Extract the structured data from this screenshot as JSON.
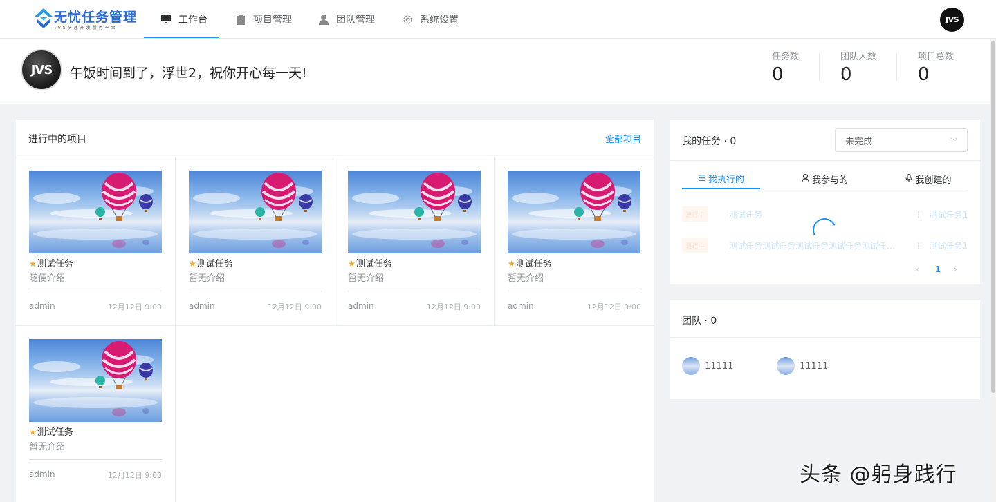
{
  "logo": {
    "title": "无忧任务管理",
    "subtitle": "JVS快速开发服务平台"
  },
  "nav": {
    "tabs": [
      {
        "label": "工作台",
        "icon": "monitor-icon"
      },
      {
        "label": "项目管理",
        "icon": "clipboard-icon"
      },
      {
        "label": "团队管理",
        "icon": "user-icon"
      },
      {
        "label": "系统设置",
        "icon": "gear-icon"
      }
    ],
    "active": "工作台",
    "avatar_text": "JVS"
  },
  "greeting": {
    "avatar_text": "JVS",
    "message": "午饭时间到了，浮世2，祝你开心每一天!",
    "stats": [
      {
        "label": "任务数",
        "value": "0"
      },
      {
        "label": "团队人数",
        "value": "0"
      },
      {
        "label": "项目总数",
        "value": "0"
      }
    ]
  },
  "projects_panel": {
    "title": "进行中的项目",
    "link": "全部项目",
    "cards": [
      {
        "name": "测试任务",
        "desc": "随便介绍",
        "owner": "admin",
        "date": "12月12日 9:00"
      },
      {
        "name": "测试任务",
        "desc": "暂无介绍",
        "owner": "admin",
        "date": "12月12日 9:00"
      },
      {
        "name": "测试任务",
        "desc": "暂无介绍",
        "owner": "admin",
        "date": "12月12日 9:00"
      },
      {
        "name": "测试任务",
        "desc": "暂无介绍",
        "owner": "admin",
        "date": "12月12日 9:00"
      },
      {
        "name": "测试任务",
        "desc": "暂无介绍",
        "owner": "admin",
        "date": "12月12日 9:00"
      }
    ]
  },
  "tasks_panel": {
    "title": "我的任务 · 0",
    "filter": "未完成",
    "tabs": [
      {
        "label": "我执行的",
        "icon": "list-icon"
      },
      {
        "label": "我参与的",
        "icon": "user-icon"
      },
      {
        "label": "我创建的",
        "icon": "mic-icon"
      }
    ],
    "active_tab": "我执行的",
    "rows": [
      {
        "tag": "进行中",
        "text": "测试任务",
        "project": "测试任务1"
      },
      {
        "tag": "进行中",
        "text": "测试任务测试任务测试任务测试任务测试任务测试任务",
        "project": "测试任务1"
      }
    ],
    "pager": {
      "prev": "‹",
      "current": "1",
      "next": "›"
    }
  },
  "team_panel": {
    "title": "团队 · 0",
    "members": [
      {
        "name": "11111"
      },
      {
        "name": "11111"
      }
    ]
  },
  "watermark": "头条 @躬身践行",
  "colors": {
    "accent": "#1890ff",
    "star": "#f5a623",
    "background": "#f0f2f5"
  }
}
